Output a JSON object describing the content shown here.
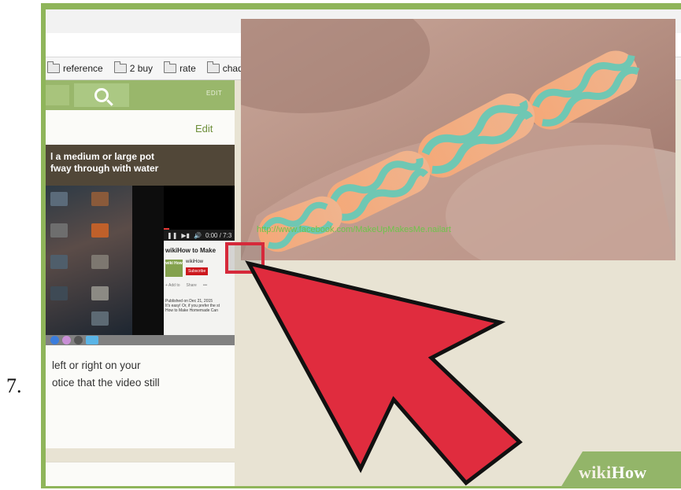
{
  "step": {
    "number": "7."
  },
  "browser": {
    "bookmarks": [
      {
        "label": "reference"
      },
      {
        "label": "2 buy"
      },
      {
        "label": "rate"
      },
      {
        "label": "chad"
      }
    ],
    "header_edit": "EDIT"
  },
  "article": {
    "edit_link": "Edit",
    "caption": [
      "l a medium or large pot",
      "fway through with water"
    ],
    "body_lines": [
      "left or right on your",
      "otice that the video still"
    ]
  },
  "video": {
    "title": "wikiHow to Make",
    "channel": "wikiHow",
    "avatar_text": "wiki How",
    "subscribe": "Subscribe",
    "actions": [
      "+ Add to",
      "Share",
      "•••"
    ],
    "published": [
      "Published on Dec 21, 2015",
      "It's easy! Or, if you prefer the st",
      "How to Make Homemade Can"
    ],
    "progress": 0.08,
    "controls_time": "0:00 / 7:3"
  },
  "popout": {
    "photo_url": "http://www.facebook.com/MakeUpMakesMe.nailart"
  },
  "brand": {
    "wiki": "wiki",
    "how": "How"
  },
  "colors": {
    "accent_green": "#99b76b",
    "arrow_red": "#e02c3e",
    "link_green": "#6e8f3a"
  }
}
